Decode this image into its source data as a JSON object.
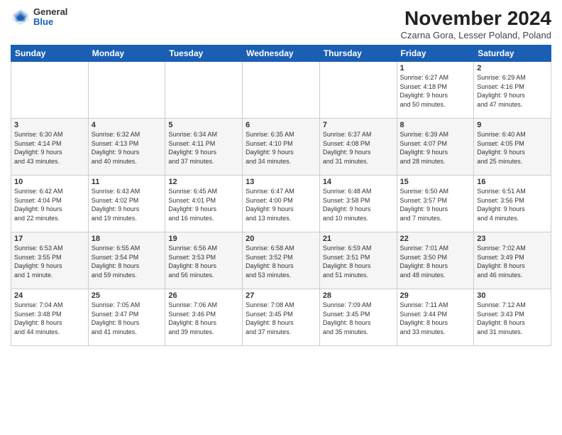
{
  "logo": {
    "general": "General",
    "blue": "Blue"
  },
  "title": "November 2024",
  "subtitle": "Czarna Gora, Lesser Poland, Poland",
  "days_header": [
    "Sunday",
    "Monday",
    "Tuesday",
    "Wednesday",
    "Thursday",
    "Friday",
    "Saturday"
  ],
  "weeks": [
    [
      {
        "day": "",
        "info": ""
      },
      {
        "day": "",
        "info": ""
      },
      {
        "day": "",
        "info": ""
      },
      {
        "day": "",
        "info": ""
      },
      {
        "day": "",
        "info": ""
      },
      {
        "day": "1",
        "info": "Sunrise: 6:27 AM\nSunset: 4:18 PM\nDaylight: 9 hours\nand 50 minutes."
      },
      {
        "day": "2",
        "info": "Sunrise: 6:29 AM\nSunset: 4:16 PM\nDaylight: 9 hours\nand 47 minutes."
      }
    ],
    [
      {
        "day": "3",
        "info": "Sunrise: 6:30 AM\nSunset: 4:14 PM\nDaylight: 9 hours\nand 43 minutes."
      },
      {
        "day": "4",
        "info": "Sunrise: 6:32 AM\nSunset: 4:13 PM\nDaylight: 9 hours\nand 40 minutes."
      },
      {
        "day": "5",
        "info": "Sunrise: 6:34 AM\nSunset: 4:11 PM\nDaylight: 9 hours\nand 37 minutes."
      },
      {
        "day": "6",
        "info": "Sunrise: 6:35 AM\nSunset: 4:10 PM\nDaylight: 9 hours\nand 34 minutes."
      },
      {
        "day": "7",
        "info": "Sunrise: 6:37 AM\nSunset: 4:08 PM\nDaylight: 9 hours\nand 31 minutes."
      },
      {
        "day": "8",
        "info": "Sunrise: 6:39 AM\nSunset: 4:07 PM\nDaylight: 9 hours\nand 28 minutes."
      },
      {
        "day": "9",
        "info": "Sunrise: 6:40 AM\nSunset: 4:05 PM\nDaylight: 9 hours\nand 25 minutes."
      }
    ],
    [
      {
        "day": "10",
        "info": "Sunrise: 6:42 AM\nSunset: 4:04 PM\nDaylight: 9 hours\nand 22 minutes."
      },
      {
        "day": "11",
        "info": "Sunrise: 6:43 AM\nSunset: 4:02 PM\nDaylight: 9 hours\nand 19 minutes."
      },
      {
        "day": "12",
        "info": "Sunrise: 6:45 AM\nSunset: 4:01 PM\nDaylight: 9 hours\nand 16 minutes."
      },
      {
        "day": "13",
        "info": "Sunrise: 6:47 AM\nSunset: 4:00 PM\nDaylight: 9 hours\nand 13 minutes."
      },
      {
        "day": "14",
        "info": "Sunrise: 6:48 AM\nSunset: 3:58 PM\nDaylight: 9 hours\nand 10 minutes."
      },
      {
        "day": "15",
        "info": "Sunrise: 6:50 AM\nSunset: 3:57 PM\nDaylight: 9 hours\nand 7 minutes."
      },
      {
        "day": "16",
        "info": "Sunrise: 6:51 AM\nSunset: 3:56 PM\nDaylight: 9 hours\nand 4 minutes."
      }
    ],
    [
      {
        "day": "17",
        "info": "Sunrise: 6:53 AM\nSunset: 3:55 PM\nDaylight: 9 hours\nand 1 minute."
      },
      {
        "day": "18",
        "info": "Sunrise: 6:55 AM\nSunset: 3:54 PM\nDaylight: 8 hours\nand 59 minutes."
      },
      {
        "day": "19",
        "info": "Sunrise: 6:56 AM\nSunset: 3:53 PM\nDaylight: 8 hours\nand 56 minutes."
      },
      {
        "day": "20",
        "info": "Sunrise: 6:58 AM\nSunset: 3:52 PM\nDaylight: 8 hours\nand 53 minutes."
      },
      {
        "day": "21",
        "info": "Sunrise: 6:59 AM\nSunset: 3:51 PM\nDaylight: 8 hours\nand 51 minutes."
      },
      {
        "day": "22",
        "info": "Sunrise: 7:01 AM\nSunset: 3:50 PM\nDaylight: 8 hours\nand 48 minutes."
      },
      {
        "day": "23",
        "info": "Sunrise: 7:02 AM\nSunset: 3:49 PM\nDaylight: 8 hours\nand 46 minutes."
      }
    ],
    [
      {
        "day": "24",
        "info": "Sunrise: 7:04 AM\nSunset: 3:48 PM\nDaylight: 8 hours\nand 44 minutes."
      },
      {
        "day": "25",
        "info": "Sunrise: 7:05 AM\nSunset: 3:47 PM\nDaylight: 8 hours\nand 41 minutes."
      },
      {
        "day": "26",
        "info": "Sunrise: 7:06 AM\nSunset: 3:46 PM\nDaylight: 8 hours\nand 39 minutes."
      },
      {
        "day": "27",
        "info": "Sunrise: 7:08 AM\nSunset: 3:45 PM\nDaylight: 8 hours\nand 37 minutes."
      },
      {
        "day": "28",
        "info": "Sunrise: 7:09 AM\nSunset: 3:45 PM\nDaylight: 8 hours\nand 35 minutes."
      },
      {
        "day": "29",
        "info": "Sunrise: 7:11 AM\nSunset: 3:44 PM\nDaylight: 8 hours\nand 33 minutes."
      },
      {
        "day": "30",
        "info": "Sunrise: 7:12 AM\nSunset: 3:43 PM\nDaylight: 8 hours\nand 31 minutes."
      }
    ]
  ]
}
